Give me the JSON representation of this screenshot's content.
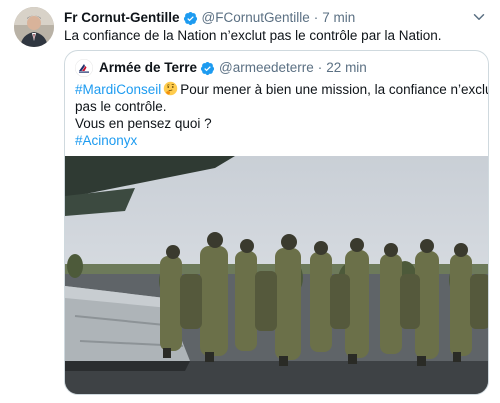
{
  "tweet": {
    "author_name": "Fr Cornut-Gentille",
    "handle": "@FCornutGentille",
    "separator": "·",
    "time": "7 min",
    "text": "La confiance de la Nation n’exclut pas le contrôle par la Nation."
  },
  "quoted": {
    "author_name": "Armée de Terre",
    "handle": "@armeedeterre",
    "separator": "·",
    "time": "22 min",
    "hashtag": "#MardiConseil",
    "line1_rest": "Pour mener à bien une mission, la confiance n’exclut",
    "line2": "pas le contrôle.",
    "line3": "Vous en pensez quoi ?",
    "line4": "#Acinonyx"
  },
  "colors": {
    "text": "#0f1419",
    "secondary": "#5b7083",
    "link": "#1d9bf0",
    "verified": "#1d9bf0",
    "border": "#cfd9de"
  }
}
